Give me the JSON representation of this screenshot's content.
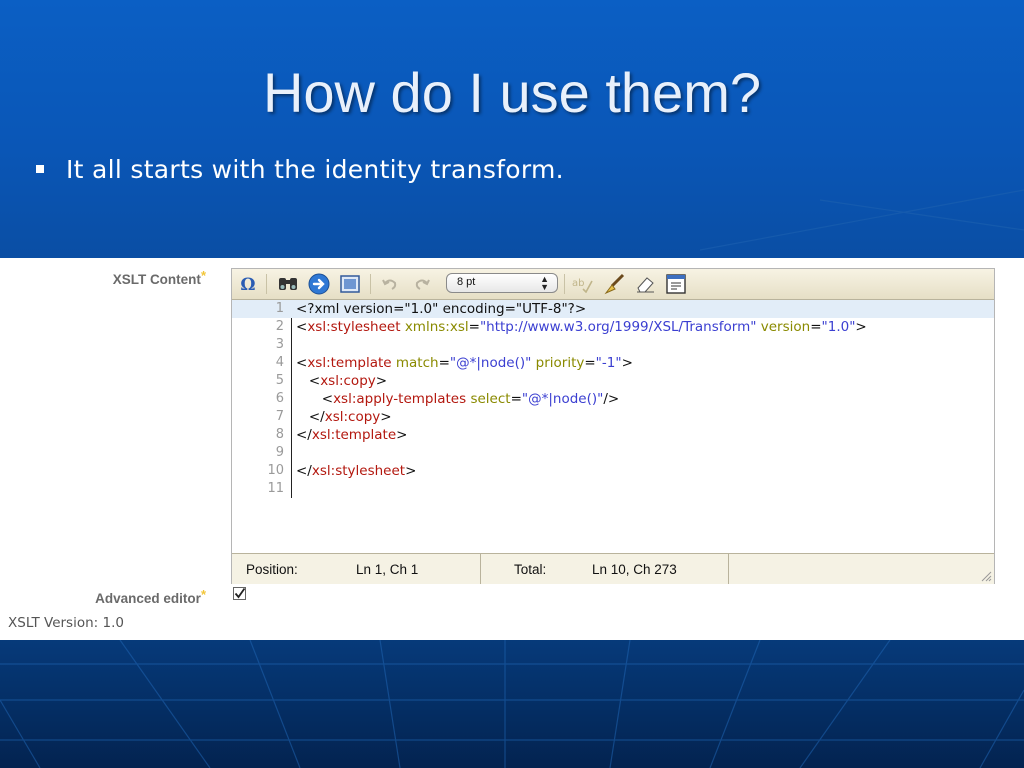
{
  "slide": {
    "title": "How do I use them?",
    "bullet": "It all starts with the identity transform."
  },
  "form": {
    "xslt_content_label": "XSLT Content",
    "advanced_editor_label": "Advanced editor",
    "advanced_editor_checked": true,
    "xslt_version_text": "XSLT Version: 1.0",
    "required_star": "*"
  },
  "toolbar": {
    "font_size_value": "8 pt",
    "buttons": [
      "omega-icon",
      "binoculars-icon",
      "goto-icon",
      "window-icon",
      "undo-icon",
      "redo-icon",
      "spellcheck-icon",
      "brush-icon",
      "eraser-icon",
      "preview-icon"
    ]
  },
  "code_lines": [
    {
      "num": "1",
      "segments": [
        {
          "text": "<?xml version=\"1.0\" encoding=\"UTF-8\"?>",
          "cls": ""
        }
      ]
    },
    {
      "num": "2",
      "segments": [
        {
          "text": "<",
          "cls": ""
        },
        {
          "text": "xsl:stylesheet",
          "cls": "t"
        },
        {
          "text": " ",
          "cls": ""
        },
        {
          "text": "xmlns:xsl",
          "cls": "a"
        },
        {
          "text": "=",
          "cls": ""
        },
        {
          "text": "\"http://www.w3.org/1999/XSL/Transform\"",
          "cls": "v"
        },
        {
          "text": " ",
          "cls": ""
        },
        {
          "text": "version",
          "cls": "a"
        },
        {
          "text": "=",
          "cls": ""
        },
        {
          "text": "\"1.0\"",
          "cls": "v"
        },
        {
          "text": ">",
          "cls": ""
        }
      ]
    },
    {
      "num": "3",
      "segments": []
    },
    {
      "num": "4",
      "segments": [
        {
          "text": "<",
          "cls": ""
        },
        {
          "text": "xsl:template",
          "cls": "t"
        },
        {
          "text": " ",
          "cls": ""
        },
        {
          "text": "match",
          "cls": "a"
        },
        {
          "text": "=",
          "cls": ""
        },
        {
          "text": "\"@*|node()\"",
          "cls": "v"
        },
        {
          "text": " ",
          "cls": ""
        },
        {
          "text": "priority",
          "cls": "a"
        },
        {
          "text": "=",
          "cls": ""
        },
        {
          "text": "\"-1\"",
          "cls": "v"
        },
        {
          "text": ">",
          "cls": ""
        }
      ]
    },
    {
      "num": "5",
      "segments": [
        {
          "text": "   <",
          "cls": ""
        },
        {
          "text": "xsl:copy",
          "cls": "t"
        },
        {
          "text": ">",
          "cls": ""
        }
      ]
    },
    {
      "num": "6",
      "segments": [
        {
          "text": "      <",
          "cls": ""
        },
        {
          "text": "xsl:apply-templates",
          "cls": "t"
        },
        {
          "text": " ",
          "cls": ""
        },
        {
          "text": "select",
          "cls": "a"
        },
        {
          "text": "=",
          "cls": ""
        },
        {
          "text": "\"@*|node()\"",
          "cls": "v"
        },
        {
          "text": "/>",
          "cls": ""
        }
      ]
    },
    {
      "num": "7",
      "segments": [
        {
          "text": "   </",
          "cls": ""
        },
        {
          "text": "xsl:copy",
          "cls": "t"
        },
        {
          "text": ">",
          "cls": ""
        }
      ]
    },
    {
      "num": "8",
      "segments": [
        {
          "text": "</",
          "cls": ""
        },
        {
          "text": "xsl:template",
          "cls": "t"
        },
        {
          "text": ">",
          "cls": ""
        }
      ]
    },
    {
      "num": "9",
      "segments": []
    },
    {
      "num": "10",
      "segments": [
        {
          "text": "</",
          "cls": ""
        },
        {
          "text": "xsl:stylesheet",
          "cls": "t"
        },
        {
          "text": ">",
          "cls": ""
        }
      ]
    },
    {
      "num": "11",
      "segments": []
    }
  ],
  "statusbar": {
    "position_label": "Position:",
    "position_value": "Ln 1, Ch 1",
    "total_label": "Total:",
    "total_value": "Ln 10, Ch 273"
  }
}
